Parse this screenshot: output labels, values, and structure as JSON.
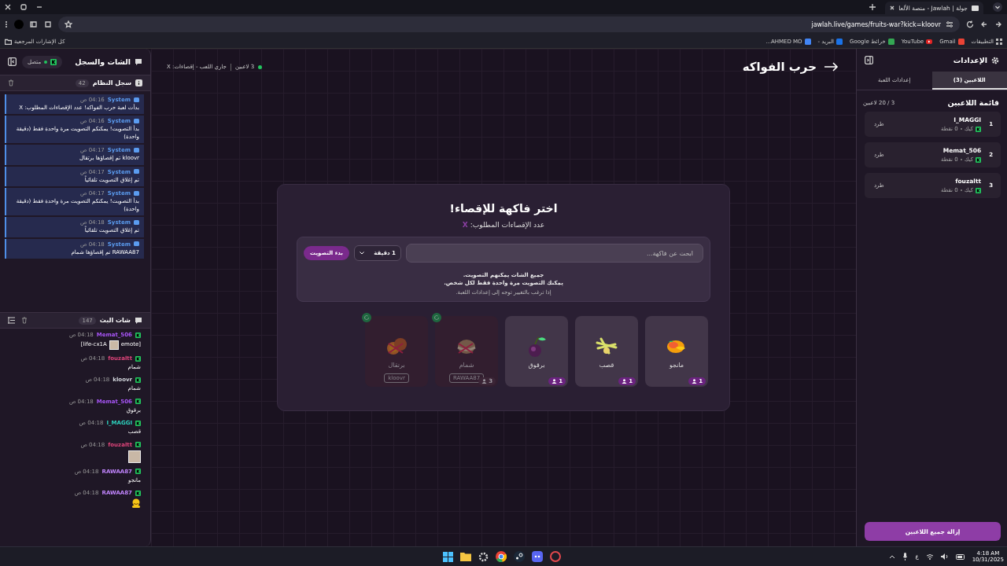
{
  "browser": {
    "tab_title": "جولة | Jawlah - منصة الألعا",
    "url": "jawlah.live/games/fruits-war?kick=kloovr",
    "bookmarks": [
      "التطبيقات",
      "Gmail",
      "YouTube",
      "خرائط Google",
      "البريد -",
      "AHMED MO..."
    ],
    "all_bookmarks": "كل الإشارات المرجعية"
  },
  "chat": {
    "title": "الشات والسجل",
    "connection": "متصل",
    "system_log": {
      "title": "سجل النظام",
      "count": "42",
      "entries": [
        {
          "sender": "System",
          "time": "04:16 ص",
          "text": "بدأت لعبة حرب الفواكه! عدد الإقصاءات المطلوب: X"
        },
        {
          "sender": "System",
          "time": "04:16 ص",
          "text": "بدأ التصويت! يمكنكم التصويت مرة واحدة فقط (دقيقة واحدة)"
        },
        {
          "sender": "System",
          "time": "04:17 ص",
          "text": "kloovr تم إقصاؤها برتقال"
        },
        {
          "sender": "System",
          "time": "04:17 ص",
          "text": "تم إغلاق التصويت تلقائياً"
        },
        {
          "sender": "System",
          "time": "04:17 ص",
          "text": "بدأ التصويت! يمكنكم التصويت مرة واحدة فقط (دقيقة واحدة)"
        },
        {
          "sender": "System",
          "time": "04:18 ص",
          "text": "تم إغلاق التصويت تلقائياً"
        },
        {
          "sender": "System",
          "time": "04:18 ص",
          "text": "RAWAA87 تم إقصاؤها شمام"
        }
      ]
    },
    "stream_chat": {
      "title": "شات البث",
      "count": "147",
      "messages": [
        {
          "user": "Memat_506",
          "color": "#a855f7",
          "time": "04:18 ص",
          "kind": "emote",
          "text_before": "[emote",
          "text_after": "life-cx1A]"
        },
        {
          "user": "fouzaltt",
          "color": "#e0457b",
          "time": "04:18 ص",
          "kind": "text",
          "text": "شمام"
        },
        {
          "user": "kloovr",
          "color": "#d1d5db",
          "time": "04:18 ص",
          "kind": "text",
          "text": "شمام"
        },
        {
          "user": "Memat_506",
          "color": "#a855f7",
          "time": "04:18 ص",
          "kind": "text",
          "text": "برقوق"
        },
        {
          "user": "I_MAGGI",
          "color": "#2dd4bf",
          "time": "04:18 ص",
          "kind": "text",
          "text": "قصب"
        },
        {
          "user": "fouzaltt",
          "color": "#e0457b",
          "time": "04:18 ص",
          "kind": "image"
        },
        {
          "user": "RAWAA87",
          "color": "#c084fc",
          "time": "04:18 ص",
          "kind": "text",
          "text": "مانجو"
        },
        {
          "user": "RAWAA87",
          "color": "#c084fc",
          "time": "04:18 ص",
          "kind": "sticker"
        }
      ]
    }
  },
  "header": {
    "title": "حرب الفواكه",
    "players": "3 لاعبين",
    "status": "جاري اللعب - إقصاءات: X"
  },
  "modal": {
    "title": "اختر فاكهة للإقصاء!",
    "required_label": "عدد الإقصاءات المطلوب:",
    "required_value": "X",
    "search_placeholder": "ابحث عن فاكهة...",
    "duration": "1 دقيقة",
    "start_button": "بدء التصويت",
    "info_lines": [
      "جميع الشات يمكنهم التصويت.",
      "يمكنك التصويت مرة واحدة فقط لكل شخص."
    ],
    "hint": "إذا ترغب بالتغيير توجه إلى إعدادات اللعبة."
  },
  "fruits": [
    {
      "kind": "mango",
      "name": "مانجو",
      "votes": "1",
      "eliminated": false
    },
    {
      "kind": "cane",
      "name": "قصب",
      "votes": "1",
      "eliminated": false
    },
    {
      "kind": "plum",
      "name": "برقوق",
      "votes": "1",
      "eliminated": false
    },
    {
      "kind": "melon",
      "name": "شمام",
      "votes": "3",
      "eliminated": true,
      "eliminated_by": "RAWAA87"
    },
    {
      "kind": "citrus",
      "name": "برتقال",
      "eliminated": true,
      "eliminated_by": "kloovr"
    }
  ],
  "settings": {
    "title": "الإعدادات",
    "tabs": [
      {
        "label": "اللاعبين (3)",
        "selected": true
      },
      {
        "label": "إعدادات اللعبة",
        "selected": false
      }
    ],
    "list_title": "قائمة اللاعبين",
    "capacity": "3 / 20 لاعبين",
    "players": [
      {
        "rank": "1",
        "name": "I_MAGGI",
        "platform": "كيك",
        "points": "0 نقطة",
        "kick": "طرد"
      },
      {
        "rank": "2",
        "name": "Memat_506",
        "platform": "كيك",
        "points": "0 نقطة",
        "kick": "طرد"
      },
      {
        "rank": "3",
        "name": "fouzaltt",
        "platform": "كيك",
        "points": "0 نقطة",
        "kick": "طرد"
      }
    ],
    "remove_all": "إزالة جميع اللاعبين"
  },
  "taskbar": {
    "language": "ع",
    "time": "4:18 AM",
    "date": "10/31/2025"
  }
}
